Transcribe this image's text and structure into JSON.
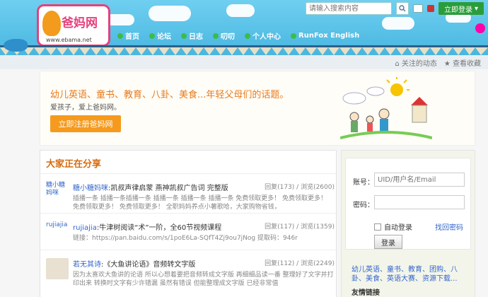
{
  "header": {
    "logo_text": "爸妈网",
    "logo_url": "www.ebama.net",
    "search_placeholder": "请输入搜索内容",
    "login_label": "立即登录",
    "nav": [
      "首页",
      "论坛",
      "日志",
      "叨叨",
      "个人中心",
      "RunFox English"
    ]
  },
  "subbar": {
    "follow": "关注的动态",
    "favorites": "查看收藏"
  },
  "banner": {
    "slogan": "幼儿英语、童书、教育、八卦、美食...年轻父母们的话题。",
    "sub_slogan": "爱孩子，爱上爸妈网。",
    "register_label": "立即注册爸妈网"
  },
  "feed": {
    "title": "大家正在分享",
    "items": [
      {
        "avatar_alt": "糖小糖妈咪",
        "user": "糖小糖妈咪",
        "title": ":凯叔声律启蒙 燕神凯叔广告词 完整版",
        "stats": "回复(173) / 浏览(2600)",
        "desc": "插播一条 插播一条插播一条 插播一条 插播一条 插播一条 免费领取更多！ 免费领取更多！ 免费领取更多！ 免费领取更多！ 全职妈妈养点小薯歌哈，大家购物省钱，"
      },
      {
        "avatar_alt": "rujiajia",
        "user": "rujiajia",
        "title": ":牛津树阅读“术”一阶，全60节视频课程",
        "stats": "回复(117) / 浏览(1359)",
        "desc": "链接：https://pan.baidu.com/s/1poE6La-SQfT4Zj9ou7jNog 提取码：946r"
      },
      {
        "avatar_alt": "若无其诗",
        "user": "若无其诗",
        "title": ":《大鱼讲论语》音频转文字版",
        "stats": "回复(112) / 浏览(2249)",
        "desc": "因为太喜欢大鱼讲的论语 所以心想着要把音频转成文字版 再细细品读一番 整理好了文字并打印出来 转换时文字有少许错漏 虽然有错误 但能整理成文字版 已经非常值"
      }
    ]
  },
  "login": {
    "account_label": "账号：",
    "account_placeholder": "UID/用户名/Email",
    "password_label": "密码：",
    "auto_login": "自动登录",
    "forgot": "找回密码",
    "submit": "登录"
  },
  "side": {
    "links": "幼儿英语、童书、教育、团购、八卦、美食、英语大赛、资源下载...",
    "friends_title": "友情链接"
  },
  "colors": {
    "accent_orange": "#f59a1d",
    "link_blue": "#3366cc",
    "header_sky": "#58c3e8",
    "login_green": "#2a9d3a"
  }
}
